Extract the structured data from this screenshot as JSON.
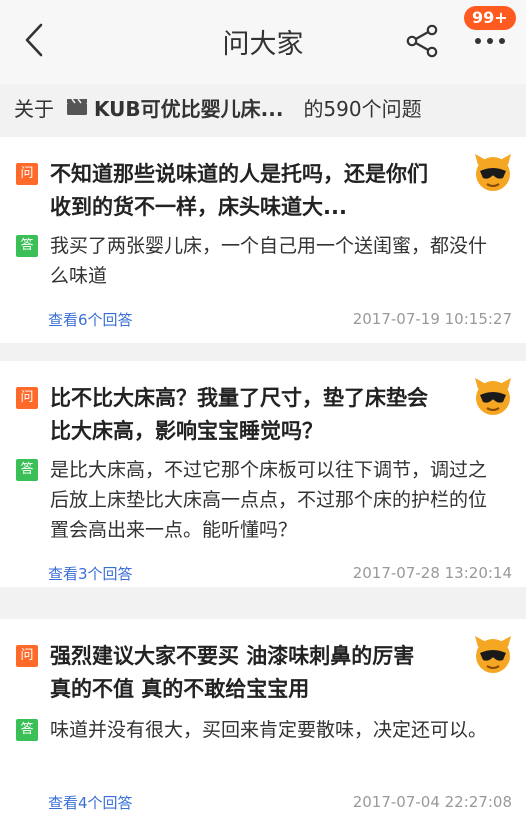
{
  "header": {
    "title": "问大家",
    "badge": "99+",
    "back_icon": "back-arrow-icon",
    "share_icon": "share-icon",
    "more_icon": "more-icon"
  },
  "subheader": {
    "prefix": "关于",
    "product": "KUB可优比婴儿床...",
    "count_text": "的590个问题"
  },
  "questions": [
    {
      "question": "不知道那些说味道的人是托吗，还是你们收到的货不一样，床头味道大...",
      "answer": "我买了两张婴儿床，一个自己用一个送闺蜜，都没什么味道",
      "link": "查看6个回答",
      "time": "2017-07-19 10:15:27",
      "q_tag": "问",
      "a_tag": "答"
    },
    {
      "question": "比不比大床高？我量了尺寸，垫了床垫会比大床高，影响宝宝睡觉吗？",
      "answer": "是比大床高，不过它那个床板可以往下调节，调过之后放上床垫比大床高一点点，不过那个床的护栏的位置会高出来一点。能听懂吗？",
      "link": "查看3个回答",
      "time": "2017-07-28 13:20:14",
      "q_tag": "问",
      "a_tag": "答"
    },
    {
      "question": "强烈建议大家不要买 油漆味刺鼻的厉害 真的不值 真的不敢给宝宝用",
      "answer": "味道并没有很大，买回来肯定要散味，决定还可以。",
      "link": "查看4个回答",
      "time": "2017-07-04 22:27:08",
      "q_tag": "问",
      "a_tag": "答"
    }
  ],
  "colors": {
    "accent_orange": "#ff6a2b",
    "answer_green": "#3bbf57",
    "link_blue": "#3a6fd8",
    "badge_red": "#ff5a1f"
  }
}
